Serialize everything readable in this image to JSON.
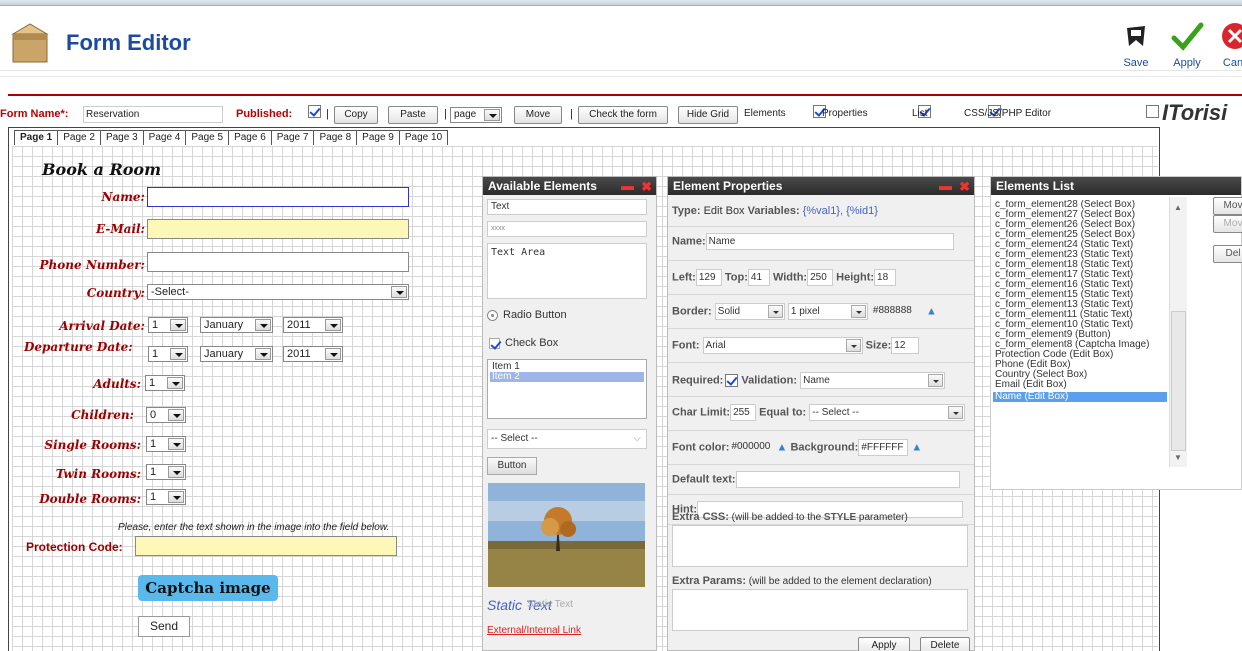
{
  "header": {
    "title": "Form Editor",
    "save": "Save",
    "apply": "Apply",
    "cancel": "Can"
  },
  "toolbar": {
    "form_name_label": "Form Name*:",
    "form_name_value": "Reservation",
    "published_label": "Published:",
    "published": true,
    "copy": "Copy",
    "paste": "Paste",
    "page_select": "page",
    "move": "Move",
    "check_form": "Check the form",
    "hide_grid": "Hide Grid",
    "elements": "Elements",
    "properties": "Properties",
    "list": "List",
    "css_editor": "CSS/JS/PHP Editor",
    "logo": "ITorisi"
  },
  "tabs": [
    "Page 1",
    "Page 2",
    "Page 3",
    "Page 4",
    "Page 5",
    "Page 6",
    "Page 7",
    "Page 8",
    "Page 9",
    "Page 10"
  ],
  "form": {
    "heading": "Book a Room",
    "name": "Name:",
    "email": "E-Mail:",
    "phone": "Phone Number:",
    "country": "Country:",
    "country_value": "-Select-",
    "arrival": "Arrival Date:",
    "departure": "Departure Date:",
    "day": "1",
    "month": "January",
    "year": "2011",
    "adults": "Adults:",
    "children": "Children:",
    "single": "Single Rooms:",
    "twin": "Twin Rooms:",
    "double": "Double Rooms:",
    "adults_v": "1",
    "children_v": "0",
    "single_v": "1",
    "twin_v": "1",
    "double_v": "1",
    "hint": "Please, enter the text shown in the image into the field below.",
    "protection": "Protection Code:",
    "captcha": "Captcha image",
    "send": "Send"
  },
  "available": {
    "title": "Available Elements",
    "text": "Text",
    "password": "xxxx",
    "textarea": "Text Area",
    "radio": "Radio Button",
    "checkbox": "Check Box",
    "list_items": [
      "Item 1",
      "Item 2"
    ],
    "select": "-- Select --",
    "button": "Button",
    "static_text": "Static Text",
    "static_ghost": "Static Text",
    "link": "External/Internal Link"
  },
  "properties": {
    "title": "Element Properties",
    "type_label": "Type:",
    "type_value": "Edit Box",
    "vars_label": "Variables:",
    "vars_value": "{%val1},  {%id1}",
    "name_label": "Name:",
    "name_value": "Name",
    "left_label": "Left:",
    "left": "129",
    "top_label": "Top:",
    "top": "41",
    "width_label": "Width:",
    "width": "250",
    "height_label": "Height:",
    "height": "18",
    "border_label": "Border:",
    "border_style": "Solid",
    "border_width": "1 pixel",
    "border_color": "#888888",
    "font_label": "Font:",
    "font_value": "Arial",
    "size_label": "Size:",
    "size_value": "12",
    "required_label": "Required:",
    "validation_label": "Validation:",
    "validation_value": "Name",
    "char_label": "Char Limit:",
    "char_value": "255",
    "equal_label": "Equal to:",
    "equal_value": "-- Select --",
    "fcolor_label": "Font color:",
    "fcolor_value": "#000000",
    "bg_label": "Background:",
    "bg_value": "#FFFFFF",
    "default_label": "Default text:",
    "hint_label": "Hint:",
    "css_label": "Extra CSS:",
    "css_note": " (will be added to the ",
    "css_style": "STYLE",
    "css_tail": " parameter)",
    "params_label": "Extra Params:",
    "params_note": " (will be added to the element declaration)",
    "apply": "Apply",
    "delete": "Delete"
  },
  "elements_list": {
    "title": "Elements List",
    "items": [
      "c_form_element28 (Select Box)",
      "c_form_element27 (Select Box)",
      "c_form_element26 (Select Box)",
      "c_form_element25 (Select Box)",
      "c_form_element24 (Static Text)",
      "c_form_element23 (Static Text)",
      "c_form_element18 (Static Text)",
      "c_form_element17 (Static Text)",
      "c_form_element16 (Static Text)",
      "c_form_element15 (Static Text)",
      "c_form_element13 (Static Text)",
      "c_form_element11 (Static Text)",
      "c_form_element10 (Static Text)",
      "c_form_element9 (Button)",
      "c_form_element8 (Captcha Image)",
      "Protection Code (Edit Box)",
      "Phone (Edit Box)",
      "Country (Select Box)",
      "Email (Edit Box)",
      "Name (Edit Box)"
    ],
    "selected": "Name (Edit Box)",
    "btn1": "Mov",
    "btn2": "Mov",
    "btn3": "Del"
  }
}
